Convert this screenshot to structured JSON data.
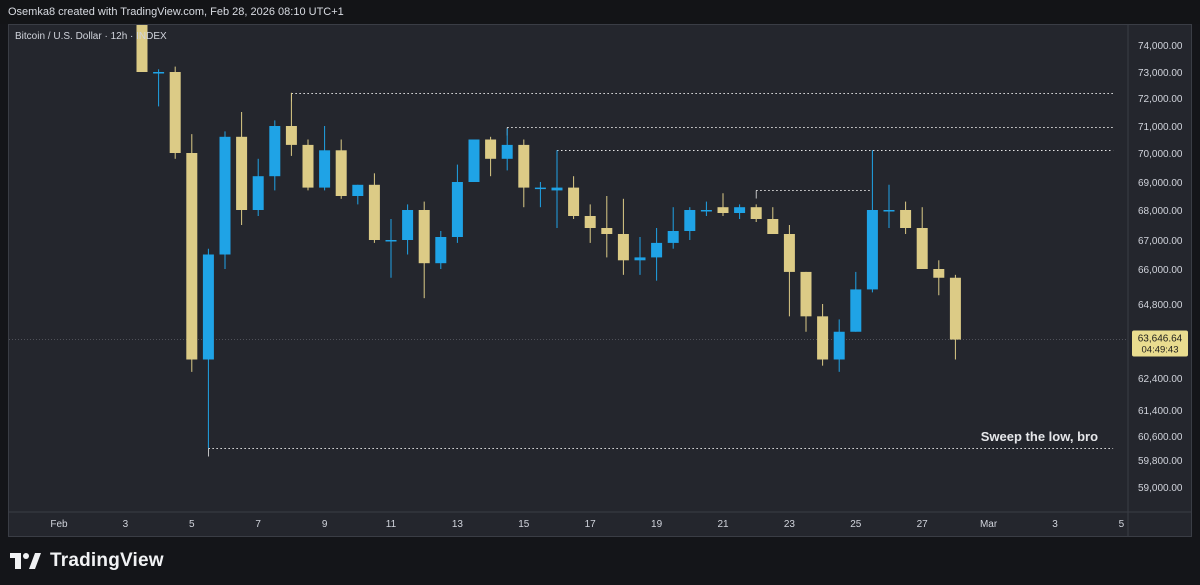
{
  "attribution": "Osemka8 created with TradingView.com, Feb 28, 2026 08:10 UTC+1",
  "footer": {
    "brand": "TradingView"
  },
  "colors": {
    "background": "#24262d",
    "up": "#1fa3e6",
    "down": "#dccb86",
    "grid_text": "#d1d4dc",
    "dotted_line": "#e6e6e6",
    "price_label_bg": "#e9dc8f"
  },
  "chart_data": {
    "type": "candlestick",
    "title": "Bitcoin / U.S. Dollar · 12h · INDEX",
    "interval": "12h",
    "y_ticks": [
      {
        "value": 74000,
        "label": "74,000.00"
      },
      {
        "value": 73000,
        "label": "73,000.00"
      },
      {
        "value": 72000,
        "label": "72,000.00"
      },
      {
        "value": 71000,
        "label": "71,000.00"
      },
      {
        "value": 70000,
        "label": "70,000.00"
      },
      {
        "value": 69000,
        "label": "69,000.00"
      },
      {
        "value": 68000,
        "label": "68,000.00"
      },
      {
        "value": 67000,
        "label": "67,000.00"
      },
      {
        "value": 66000,
        "label": "66,000.00"
      },
      {
        "value": 64800,
        "label": "64,800.00"
      },
      {
        "value": 62400,
        "label": "62,400.00"
      },
      {
        "value": 61400,
        "label": "61,400.00"
      },
      {
        "value": 60600,
        "label": "60,600.00"
      },
      {
        "value": 59800,
        "label": "59,800.00"
      },
      {
        "value": 59000,
        "label": "59,000.00"
      }
    ],
    "x_ticks": [
      {
        "t": 0,
        "label": "Feb"
      },
      {
        "t": 4,
        "label": "3"
      },
      {
        "t": 8,
        "label": "5"
      },
      {
        "t": 12,
        "label": "7"
      },
      {
        "t": 16,
        "label": "9"
      },
      {
        "t": 20,
        "label": "11"
      },
      {
        "t": 24,
        "label": "13"
      },
      {
        "t": 28,
        "label": "15"
      },
      {
        "t": 32,
        "label": "17"
      },
      {
        "t": 36,
        "label": "19"
      },
      {
        "t": 40,
        "label": "21"
      },
      {
        "t": 44,
        "label": "23"
      },
      {
        "t": 48,
        "label": "25"
      },
      {
        "t": 52,
        "label": "27"
      },
      {
        "t": 56,
        "label": "Mar"
      },
      {
        "t": 60,
        "label": "3"
      },
      {
        "t": 64,
        "label": "5"
      }
    ],
    "candles": [
      {
        "t": 5,
        "open": 75500,
        "high": 75600,
        "low": 73000,
        "close": 73000
      },
      {
        "t": 6,
        "open": 73000,
        "high": 73100,
        "low": 71700,
        "close": 73000
      },
      {
        "t": 7,
        "open": 73000,
        "high": 73200,
        "low": 69800,
        "close": 70000
      },
      {
        "t": 8,
        "open": 70000,
        "high": 70700,
        "low": 62600,
        "close": 63000
      },
      {
        "t": 9,
        "open": 63000,
        "high": 66700,
        "low": 60200,
        "close": 66500
      },
      {
        "t": 10,
        "open": 66500,
        "high": 70800,
        "low": 66000,
        "close": 70600
      },
      {
        "t": 11,
        "open": 70600,
        "high": 71500,
        "low": 67500,
        "close": 68000
      },
      {
        "t": 12,
        "open": 68000,
        "high": 69800,
        "low": 67800,
        "close": 69200
      },
      {
        "t": 13,
        "open": 69200,
        "high": 71200,
        "low": 68700,
        "close": 71000
      },
      {
        "t": 14,
        "open": 71000,
        "high": 72200,
        "low": 69900,
        "close": 70300
      },
      {
        "t": 15,
        "open": 70300,
        "high": 70500,
        "low": 68700,
        "close": 68800
      },
      {
        "t": 16,
        "open": 68800,
        "high": 71000,
        "low": 68700,
        "close": 70100
      },
      {
        "t": 17,
        "open": 70100,
        "high": 70500,
        "low": 68400,
        "close": 68500
      },
      {
        "t": 18,
        "open": 68500,
        "high": 68900,
        "low": 68200,
        "close": 68900
      },
      {
        "t": 19,
        "open": 68900,
        "high": 69300,
        "low": 66900,
        "close": 67000
      },
      {
        "t": 20,
        "open": 67000,
        "high": 67700,
        "low": 65700,
        "close": 67000
      },
      {
        "t": 21,
        "open": 67000,
        "high": 68200,
        "low": 66500,
        "close": 68000
      },
      {
        "t": 22,
        "open": 68000,
        "high": 68300,
        "low": 65000,
        "close": 66200
      },
      {
        "t": 23,
        "open": 66200,
        "high": 67300,
        "low": 66000,
        "close": 67100
      },
      {
        "t": 24,
        "open": 67100,
        "high": 69600,
        "low": 66900,
        "close": 69000
      },
      {
        "t": 25,
        "open": 69000,
        "high": 70500,
        "low": 69000,
        "close": 70500
      },
      {
        "t": 26,
        "open": 70500,
        "high": 70600,
        "low": 69200,
        "close": 69800
      },
      {
        "t": 27,
        "open": 69800,
        "high": 70900,
        "low": 69400,
        "close": 70300
      },
      {
        "t": 28,
        "open": 70300,
        "high": 70500,
        "low": 68100,
        "close": 68800
      },
      {
        "t": 29,
        "open": 68800,
        "high": 69000,
        "low": 68100,
        "close": 68800
      },
      {
        "t": 30,
        "open": 68700,
        "high": 70100,
        "low": 67400,
        "close": 68800
      },
      {
        "t": 31,
        "open": 68800,
        "high": 69200,
        "low": 67700,
        "close": 67800
      },
      {
        "t": 32,
        "open": 67800,
        "high": 68200,
        "low": 66900,
        "close": 67400
      },
      {
        "t": 33,
        "open": 67400,
        "high": 68500,
        "low": 66400,
        "close": 67200
      },
      {
        "t": 34,
        "open": 67200,
        "high": 68400,
        "low": 65800,
        "close": 66300
      },
      {
        "t": 35,
        "open": 66300,
        "high": 67100,
        "low": 65800,
        "close": 66400
      },
      {
        "t": 36,
        "open": 66400,
        "high": 67400,
        "low": 65600,
        "close": 66900
      },
      {
        "t": 37,
        "open": 66900,
        "high": 68100,
        "low": 66700,
        "close": 67300
      },
      {
        "t": 38,
        "open": 67300,
        "high": 68100,
        "low": 67000,
        "close": 68000
      },
      {
        "t": 39,
        "open": 68000,
        "high": 68300,
        "low": 67800,
        "close": 68000
      },
      {
        "t": 40,
        "open": 68100,
        "high": 68600,
        "low": 67800,
        "close": 67900
      },
      {
        "t": 41,
        "open": 67900,
        "high": 68200,
        "low": 67700,
        "close": 68100
      },
      {
        "t": 42,
        "open": 68100,
        "high": 68200,
        "low": 67600,
        "close": 67700
      },
      {
        "t": 43,
        "open": 67700,
        "high": 68100,
        "low": 67200,
        "close": 67200
      },
      {
        "t": 44,
        "open": 67200,
        "high": 67500,
        "low": 64400,
        "close": 65900
      },
      {
        "t": 45,
        "open": 65900,
        "high": 65900,
        "low": 63900,
        "close": 64400
      },
      {
        "t": 46,
        "open": 64400,
        "high": 64800,
        "low": 62800,
        "close": 63000
      },
      {
        "t": 47,
        "open": 63000,
        "high": 64300,
        "low": 62600,
        "close": 63900
      },
      {
        "t": 48,
        "open": 63900,
        "high": 65900,
        "low": 63900,
        "close": 65300
      },
      {
        "t": 49,
        "open": 65300,
        "high": 70100,
        "low": 65200,
        "close": 68000
      },
      {
        "t": 50,
        "open": 68000,
        "high": 68900,
        "low": 67400,
        "close": 68000
      },
      {
        "t": 51,
        "open": 68000,
        "high": 68300,
        "low": 67200,
        "close": 67400
      },
      {
        "t": 52,
        "open": 67400,
        "high": 68100,
        "low": 66000,
        "close": 66000
      },
      {
        "t": 53,
        "open": 66000,
        "high": 66300,
        "low": 65100,
        "close": 65700
      },
      {
        "t": 54,
        "open": 65700,
        "high": 65800,
        "low": 63000,
        "close": 63647
      }
    ],
    "horizontal_lines": [
      {
        "price": 72200,
        "t_start": 14,
        "t_end": 63.5
      },
      {
        "price": 70950,
        "t_start": 27,
        "t_end": 63.5
      },
      {
        "price": 70100,
        "t_start": 30,
        "t_end": 63.5
      },
      {
        "price": 68700,
        "t_start": 42,
        "t_end": 49
      },
      {
        "price": 60200,
        "t_start": 9,
        "t_end": 63.5
      }
    ],
    "annotation": {
      "text": "Sweep the low, bro",
      "price": 60600,
      "t": 59
    },
    "last_price": {
      "value": 63646.64,
      "label": "63,646.64",
      "countdown": "04:49:43"
    }
  }
}
